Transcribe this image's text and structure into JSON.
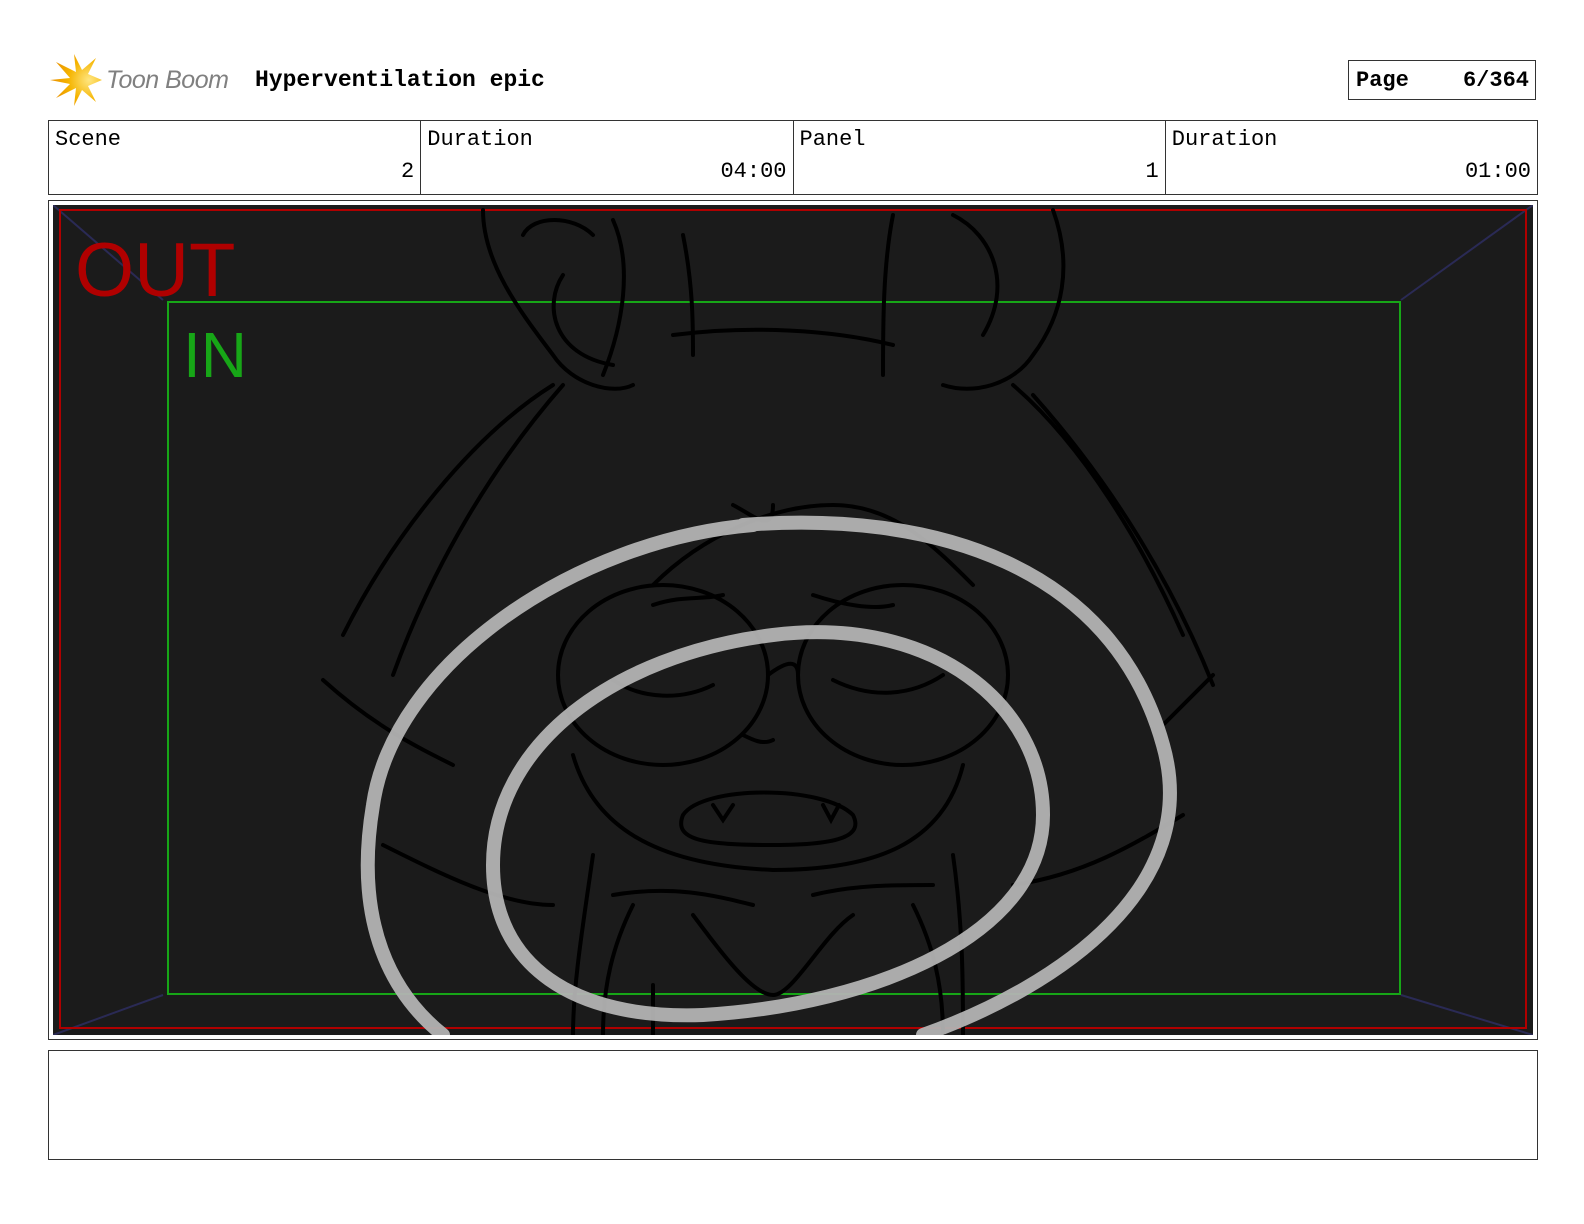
{
  "header": {
    "logo_text": "Toon Boom",
    "logo_icon": "starburst-icon",
    "project_title": "Hyperventilation epic",
    "page_label": "Page",
    "page_value": "6/364"
  },
  "info": [
    {
      "label": "Scene",
      "value": "2"
    },
    {
      "label": "Duration",
      "value": "04:00"
    },
    {
      "label": "Panel",
      "value": "1"
    },
    {
      "label": "Duration",
      "value": "01:00"
    }
  ],
  "panel": {
    "out_label": "OUT",
    "in_label": "IN"
  },
  "colors": {
    "panel_background": "#1b1b1b",
    "out_frame": "#b00000",
    "in_frame": "#17a617",
    "sketch_lines": "#000000",
    "circle_strokes": "#b3b3b3",
    "logo_orange": "#f5a400"
  },
  "notes": {
    "text": ""
  }
}
